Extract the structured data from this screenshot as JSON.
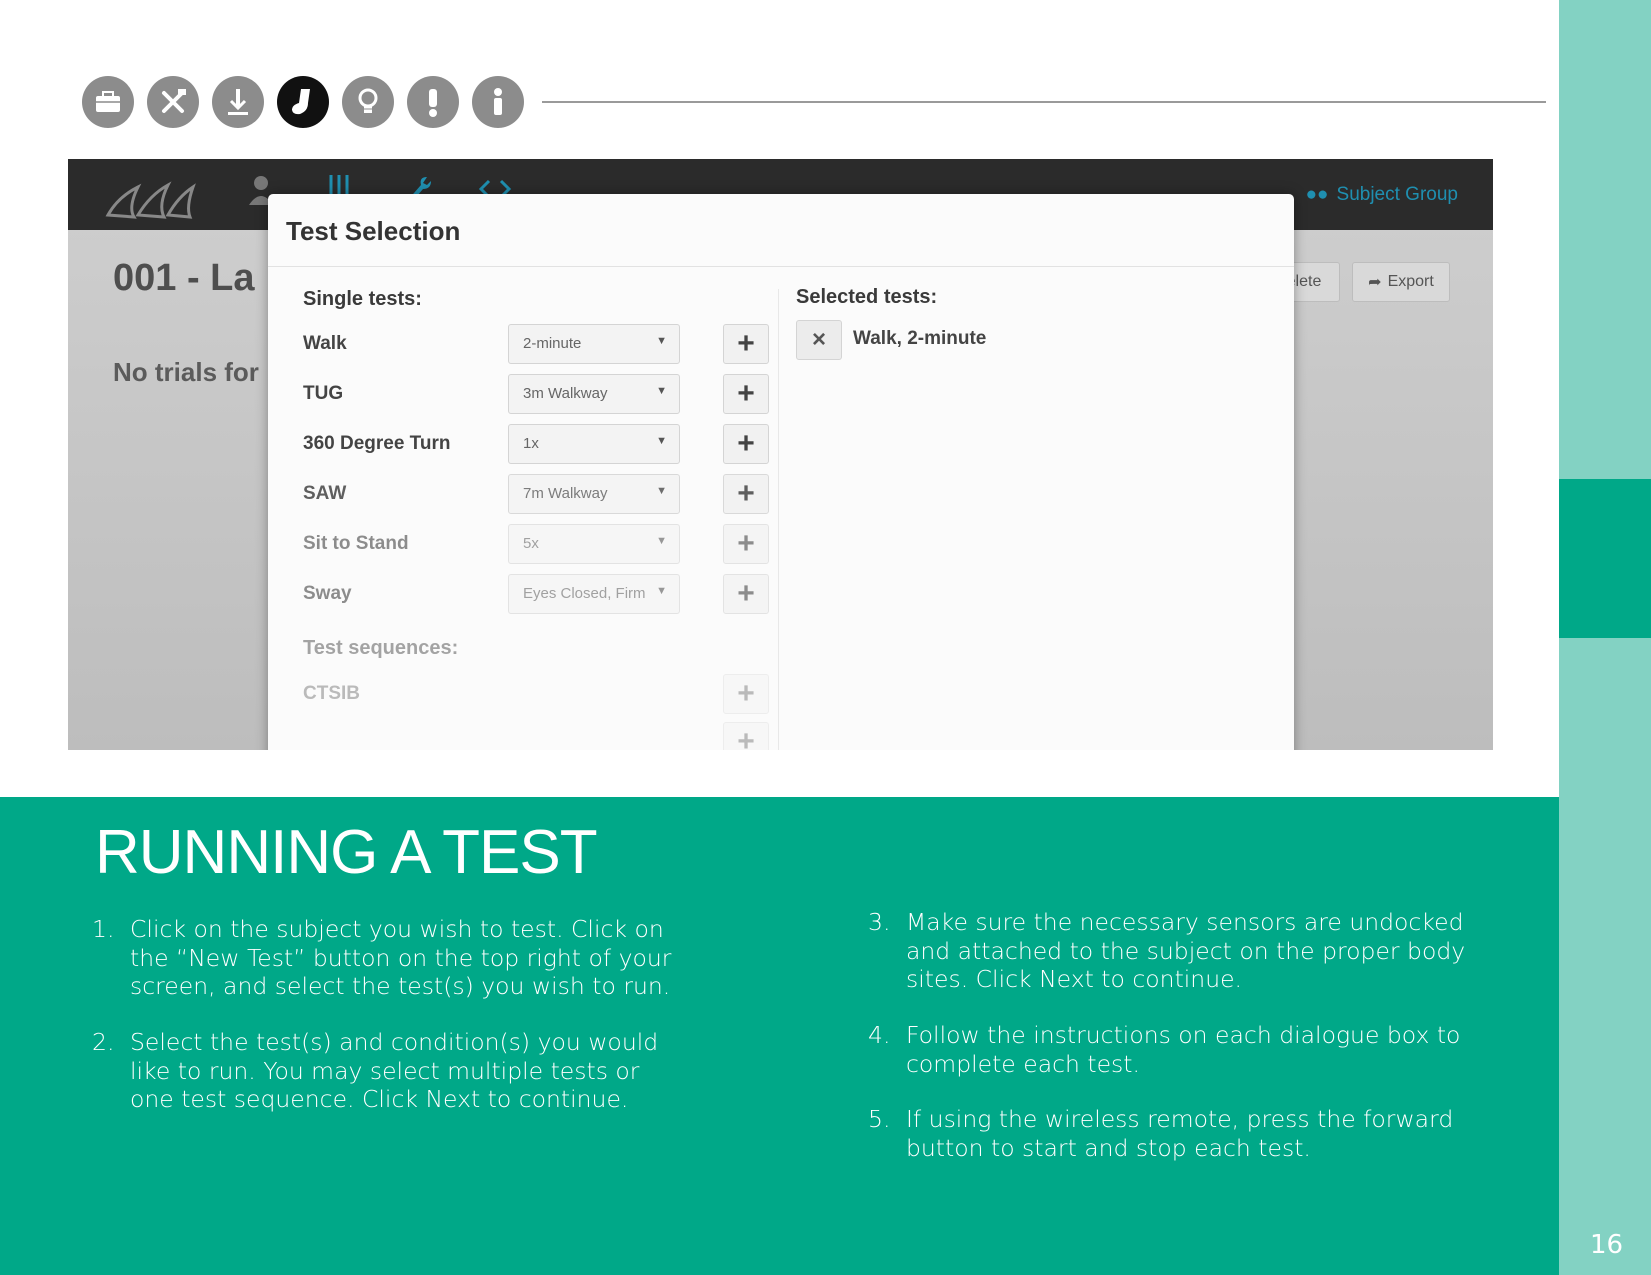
{
  "page_number": "16",
  "nav_icons": [
    {
      "name": "briefcase-icon",
      "active": false
    },
    {
      "name": "tools-icon",
      "active": false
    },
    {
      "name": "download-icon",
      "active": false
    },
    {
      "name": "sock-icon",
      "active": true
    },
    {
      "name": "lightbulb-icon",
      "active": false
    },
    {
      "name": "exclamation-icon",
      "active": false
    },
    {
      "name": "info-icon",
      "active": false
    }
  ],
  "colors": {
    "teal": "#00a888",
    "teal_light": "#83d2c3",
    "icon_gray": "#8c8c8c",
    "icon_active": "#111111"
  },
  "app": {
    "subject_group": "Subject Group",
    "title": "001 - La",
    "subtitle": "No trials for",
    "delete_label": "elete",
    "export_label": "Export",
    "modal": {
      "title": "Test Selection",
      "single_tests_label": "Single tests:",
      "tests": [
        {
          "name": "Walk",
          "option": "2-minute"
        },
        {
          "name": "TUG",
          "option": "3m Walkway"
        },
        {
          "name": "360 Degree Turn",
          "option": "1x"
        },
        {
          "name": "SAW",
          "option": "7m Walkway"
        },
        {
          "name": "Sit to Stand",
          "option": "5x"
        },
        {
          "name": "Sway",
          "option": "Eyes Closed, Firm"
        }
      ],
      "sequences_label": "Test sequences:",
      "sequences": [
        {
          "name": "CTSIB"
        }
      ],
      "add_symbol": "+",
      "selected_label": "Selected tests:",
      "selected": [
        {
          "name": "Walk, 2-minute"
        }
      ],
      "remove_symbol": "×"
    }
  },
  "heading": "RUNNING A TEST",
  "steps": [
    {
      "num": "1.",
      "text": "Click on the subject you wish to test. Click on the “New Test” button on the top right of your screen, and select the test(s) you wish to run."
    },
    {
      "num": "2.",
      "text": "Select the test(s) and condition(s) you would like to run. You may select multiple tests or one test sequence. Click Next to continue."
    },
    {
      "num": "3.",
      "text": "Make sure the necessary sensors are undocked and attached to the subject on the proper body sites. Click Next to continue."
    },
    {
      "num": "4.",
      "text": "Follow the instructions on each dialogue box to complete each test."
    },
    {
      "num": "5.",
      "text": "If using the wireless remote, press the forward button to start and stop each test."
    }
  ]
}
